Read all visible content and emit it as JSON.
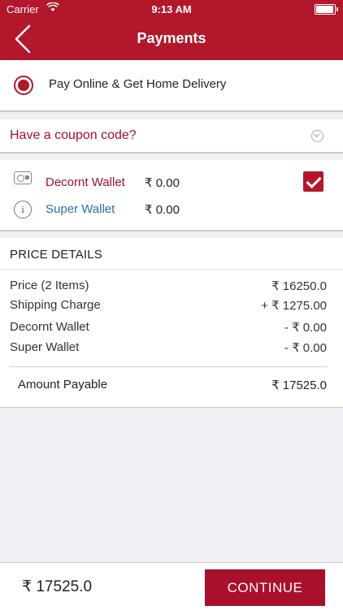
{
  "status_bar": {
    "carrier": "Carrier",
    "time": "9:13 AM"
  },
  "nav": {
    "title": "Payments"
  },
  "payment_option": {
    "label": "Pay Online & Get Home Delivery"
  },
  "coupon": {
    "label": "Have a coupon code?"
  },
  "wallets": [
    {
      "name": "Decornt Wallet",
      "value": "₹ 0.00",
      "checked": true
    },
    {
      "name": "Super Wallet",
      "value": "₹ 0.00"
    }
  ],
  "price_details": {
    "heading": "PRICE DETAILS",
    "rows": [
      {
        "label": "Price (2 Items)",
        "value": "₹ 16250.0"
      },
      {
        "label": "Shipping Charge",
        "value": "+ ₹ 1275.00"
      },
      {
        "label": "Decornt Wallet",
        "value": "- ₹ 0.00"
      },
      {
        "label": "Super Wallet",
        "value": "- ₹ 0.00"
      }
    ],
    "amount_payable": {
      "label": "Amount Payable",
      "value": "₹ 17525.0"
    }
  },
  "bottom_bar": {
    "total": "₹ 17525.0",
    "continue_label": "CONTINUE"
  },
  "colors": {
    "brand": "#b3172b",
    "accent_red": "#a8102c",
    "link_blue": "#2a6fa8",
    "background": "#efeff4"
  }
}
